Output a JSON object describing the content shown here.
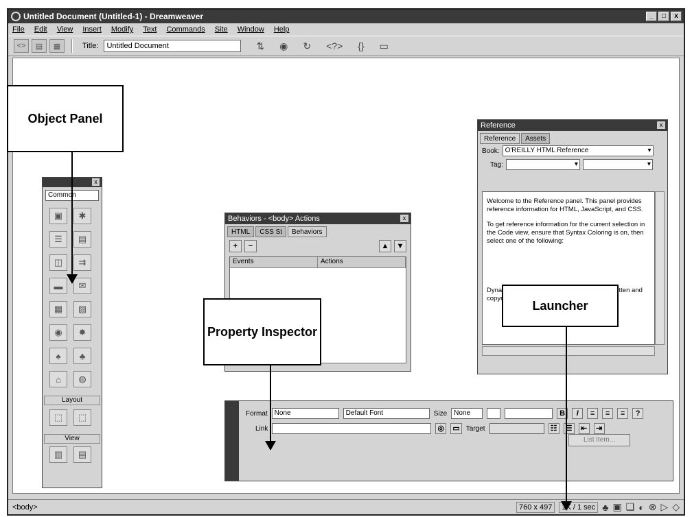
{
  "window": {
    "title": "Untitled Document (Untitled-1) - Dreamweaver",
    "controls": [
      "_",
      "□",
      "x"
    ]
  },
  "menu": [
    "File",
    "Edit",
    "View",
    "Insert",
    "Modify",
    "Text",
    "Commands",
    "Site",
    "Window",
    "Help"
  ],
  "toolbar": {
    "title_label": "Title:",
    "title_value": "Untitled Document"
  },
  "callouts": {
    "object_panel": "Object Panel",
    "property_inspector": "Property Inspector",
    "launcher": "Launcher"
  },
  "object_panel": {
    "category": "Common",
    "sections": [
      "Layout",
      "View"
    ]
  },
  "behaviors": {
    "title": "Behaviors - <body> Actions",
    "tabs": [
      "HTML",
      "CSS St",
      "Behaviors"
    ],
    "columns": [
      "Events",
      "Actions"
    ]
  },
  "reference": {
    "title": "Reference",
    "tabs": [
      "Reference",
      "Assets"
    ],
    "book_label": "Book:",
    "book_value": "O'REILLY HTML Reference",
    "tag_label": "Tag:",
    "para1": "Welcome to the Reference panel. This panel provides reference information for HTML, JavaScript, and CSS.",
    "para2": "To get reference information for the current selection in the Code view, ensure that Syntax Coloring is on, then select one of the following:",
    "para3": "Dynamic HTML: The Definitive Reference, written and copyrighted by Danny Goodman, is"
  },
  "property_inspector": {
    "format_label": "Format",
    "format_value": "None",
    "font_value": "Default Font",
    "size_label": "Size",
    "size_value": "None",
    "link_label": "Link",
    "target_label": "Target",
    "list_item_label": "List Item..."
  },
  "statusbar": {
    "tag": "<body>",
    "dimensions": "760 x 497",
    "download": "1K / 1 sec"
  }
}
